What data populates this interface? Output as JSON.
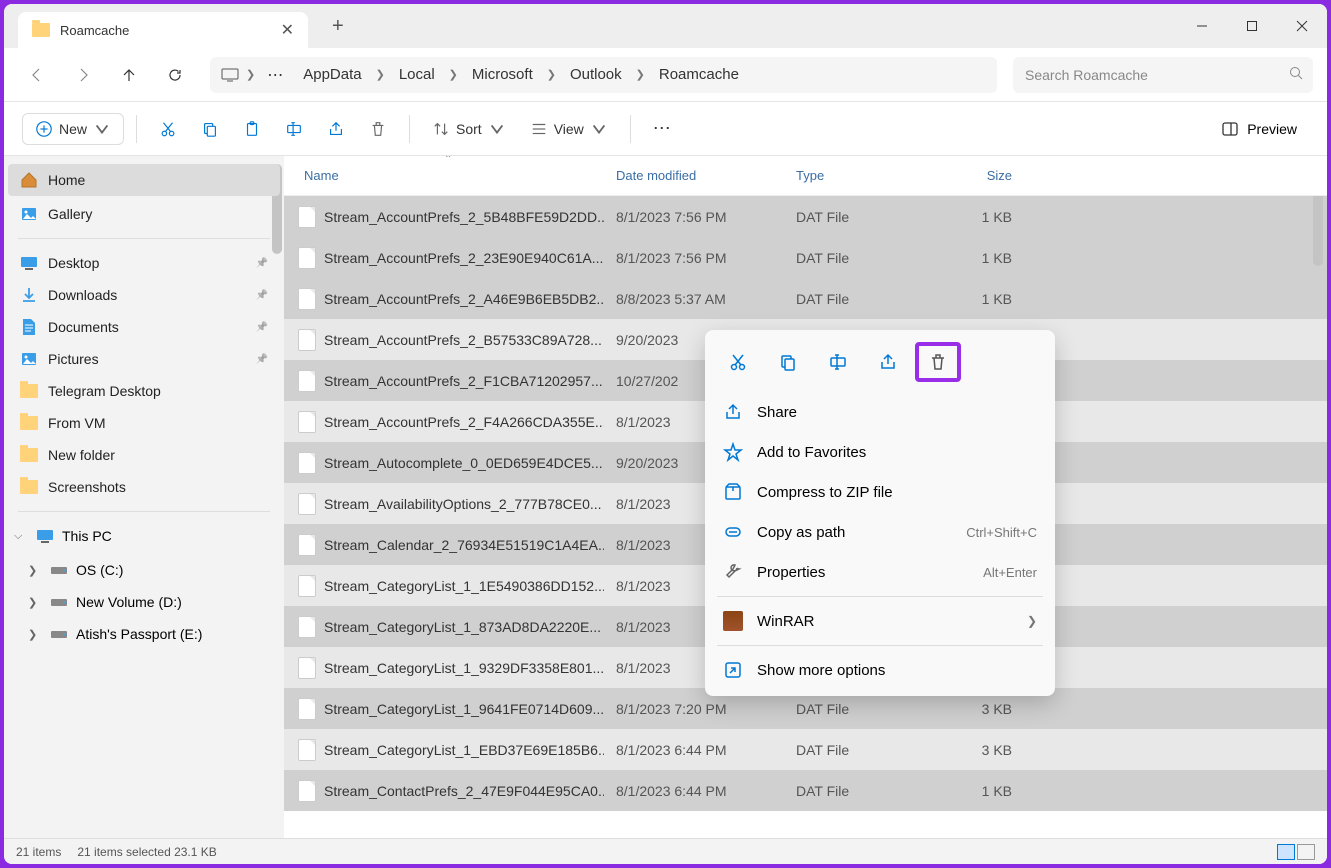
{
  "tab": {
    "title": "Roamcache"
  },
  "breadcrumb": [
    "AppData",
    "Local",
    "Microsoft",
    "Outlook",
    "Roamcache"
  ],
  "search": {
    "placeholder": "Search Roamcache"
  },
  "toolbar": {
    "new": "New",
    "sort": "Sort",
    "view": "View",
    "preview": "Preview"
  },
  "sidebar": {
    "home": "Home",
    "gallery": "Gallery",
    "quick": [
      {
        "label": "Desktop",
        "pin": true
      },
      {
        "label": "Downloads",
        "pin": true
      },
      {
        "label": "Documents",
        "pin": true
      },
      {
        "label": "Pictures",
        "pin": true
      },
      {
        "label": "Telegram Desktop",
        "pin": false
      },
      {
        "label": "From VM",
        "pin": false
      },
      {
        "label": "New folder",
        "pin": false
      },
      {
        "label": "Screenshots",
        "pin": false
      }
    ],
    "thispc": "This PC",
    "drives": [
      "OS (C:)",
      "New Volume (D:)",
      "Atish's Passport  (E:)"
    ]
  },
  "columns": {
    "name": "Name",
    "date": "Date modified",
    "type": "Type",
    "size": "Size"
  },
  "files": [
    {
      "name": "Stream_AccountPrefs_2_5B48BFE59D2DD...",
      "date": "8/1/2023 7:56 PM",
      "type": "DAT File",
      "size": "1 KB",
      "sel": true
    },
    {
      "name": "Stream_AccountPrefs_2_23E90E940C61A...",
      "date": "8/1/2023 7:56 PM",
      "type": "DAT File",
      "size": "1 KB",
      "sel": true
    },
    {
      "name": "Stream_AccountPrefs_2_A46E9B6EB5DB2...",
      "date": "8/8/2023 5:37 AM",
      "type": "DAT File",
      "size": "1 KB",
      "sel": true
    },
    {
      "name": "Stream_AccountPrefs_2_B57533C89A728...",
      "date": "9/20/2023",
      "type": "",
      "size": "",
      "sel": false
    },
    {
      "name": "Stream_AccountPrefs_2_F1CBA71202957...",
      "date": "10/27/202",
      "type": "",
      "size": "",
      "sel": true
    },
    {
      "name": "Stream_AccountPrefs_2_F4A266CDA355E...",
      "date": "8/1/2023",
      "type": "",
      "size": "",
      "sel": false
    },
    {
      "name": "Stream_Autocomplete_0_0ED659E4DCE5...",
      "date": "9/20/2023",
      "type": "",
      "size": "",
      "sel": true
    },
    {
      "name": "Stream_AvailabilityOptions_2_777B78CE0...",
      "date": "8/1/2023",
      "type": "",
      "size": "",
      "sel": false
    },
    {
      "name": "Stream_Calendar_2_76934E51519C1A4EA...",
      "date": "8/1/2023",
      "type": "",
      "size": "",
      "sel": true
    },
    {
      "name": "Stream_CategoryList_1_1E5490386DD152...",
      "date": "8/1/2023",
      "type": "",
      "size": "",
      "sel": false
    },
    {
      "name": "Stream_CategoryList_1_873AD8DA2220E...",
      "date": "8/1/2023",
      "type": "",
      "size": "",
      "sel": true
    },
    {
      "name": "Stream_CategoryList_1_9329DF3358E801...",
      "date": "8/1/2023",
      "type": "",
      "size": "",
      "sel": false
    },
    {
      "name": "Stream_CategoryList_1_9641FE0714D609...",
      "date": "8/1/2023 7:20 PM",
      "type": "DAT File",
      "size": "3 KB",
      "sel": true
    },
    {
      "name": "Stream_CategoryList_1_EBD37E69E185B6...",
      "date": "8/1/2023 6:44 PM",
      "type": "DAT File",
      "size": "3 KB",
      "sel": false
    },
    {
      "name": "Stream_ContactPrefs_2_47E9F044E95CA0...",
      "date": "8/1/2023 6:44 PM",
      "type": "DAT File",
      "size": "1 KB",
      "sel": true
    }
  ],
  "context": {
    "share": "Share",
    "favorites": "Add to Favorites",
    "compress": "Compress to ZIP file",
    "copypath": "Copy as path",
    "copypath_key": "Ctrl+Shift+C",
    "properties": "Properties",
    "properties_key": "Alt+Enter",
    "winrar": "WinRAR",
    "more": "Show more options"
  },
  "status": {
    "items": "21 items",
    "selected": "21 items selected  23.1 KB"
  }
}
